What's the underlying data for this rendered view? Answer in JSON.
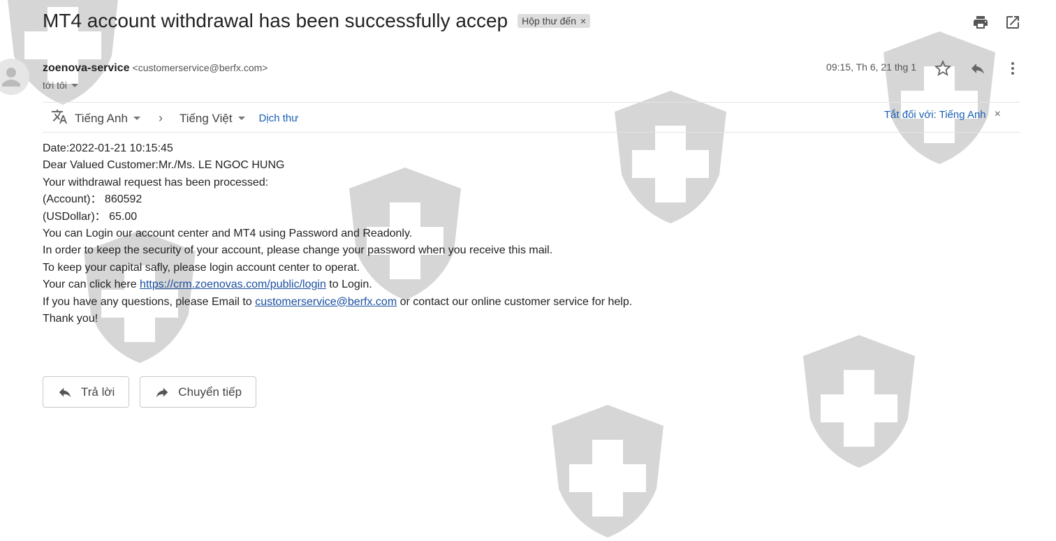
{
  "subject": "MT4 account withdrawal has been successfully accep",
  "inbox_chip": {
    "label": "Hộp thư đến",
    "close": "×"
  },
  "icons": {
    "print": "print-icon",
    "open_new_window": "open-in-new-window-icon",
    "avatar": "person-avatar-icon",
    "star": "star-icon",
    "reply": "reply-icon",
    "more": "more-vert-icon",
    "translate": "translate-icon"
  },
  "sender": {
    "name": "zoenova-service",
    "email": "<customerservice@berfx.com>",
    "to": "tới tôi",
    "time": "09:15, Th 6, 21 thg 1"
  },
  "translate_bar": {
    "from_lang": "Tiếng Anh",
    "chevron": "›",
    "to_lang": "Tiếng Việt",
    "translate_link": "Dịch thư",
    "turn_off": "Tắt đối với: Tiếng Anh",
    "close": "×"
  },
  "body": {
    "line1": "Date:2022-01-21 10:15:45",
    "line2": "Dear Valued Customer:Mr./Ms. LE NGOC HUNG",
    "line3": "Your withdrawal request has been processed:",
    "line4": "(Account)：  860592",
    "line5": "(USDollar)：  65.00",
    "line6": "You can Login our account center and MT4 using Password and Readonly.",
    "line7": "In order to keep the security of your account, please change your password when you receive this mail.",
    "line8": "To keep your capital safly, please login account center to operat.",
    "line9_pre": "Your can click here ",
    "line9_link": "https://crm.zoenovas.com/public/login",
    "line9_post": " to Login.",
    "line10_pre": "If you have any questions, please Email to ",
    "line10_link": "customerservice@berfx.com",
    "line10_post": " or contact our online customer service for help.",
    "line11": "Thank you!"
  },
  "buttons": {
    "reply": "Trả lời",
    "forward": "Chuyển tiếp"
  },
  "colors": {
    "link": "#1a5fb4",
    "watermark": "#d6d6d6"
  }
}
